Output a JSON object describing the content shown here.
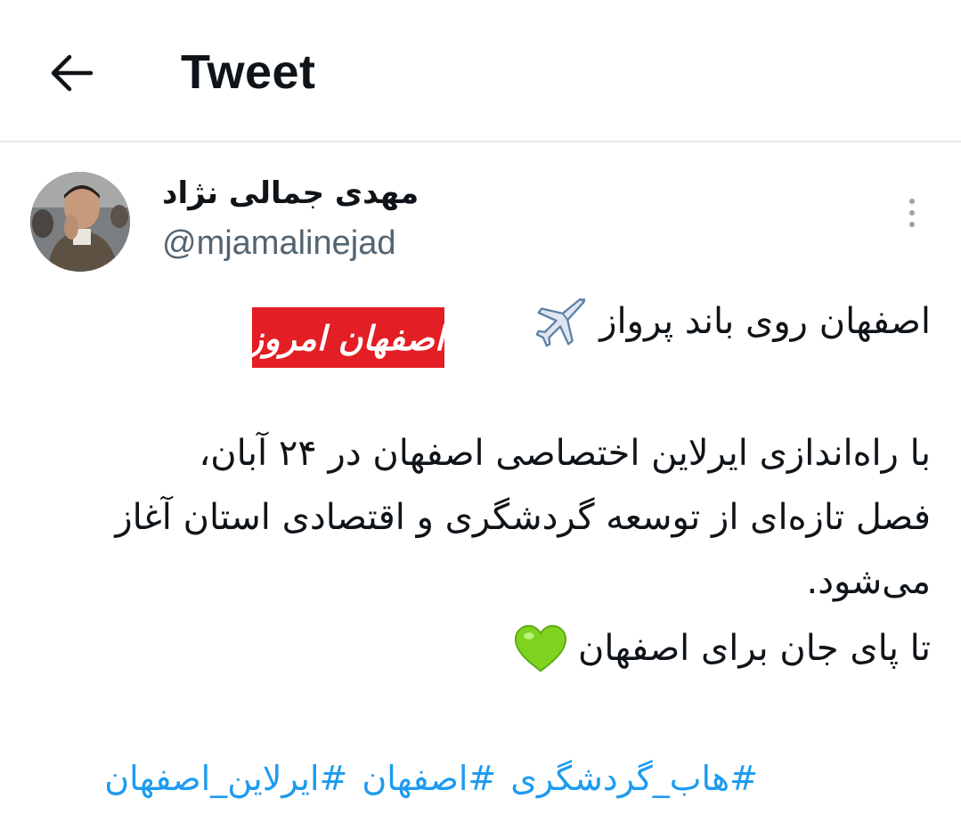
{
  "header": {
    "title": "Tweet",
    "back_icon": "arrow-left-icon"
  },
  "author": {
    "display_name": "مهدی جمالی نژاد",
    "handle": "@mjamalinejad",
    "more_icon": "more-vertical-icon"
  },
  "tweet": {
    "headline": "اصفهان روی باند پرواز",
    "headline_emoji": "airplane-icon",
    "brand_logo_text": "اصفهان امروز",
    "lines": [
      "با راه‌اندازی ایرلاین اختصاصی اصفهان در ۲۴ آبان،",
      "فصل تازه‌ای از توسعه گردشگری و اقتصادی استان آغاز",
      "می‌شود."
    ],
    "closing": "تا پای جان برای اصفهان",
    "closing_emoji": "green-heart-icon",
    "hashtags": [
      "#هاب_گردشگری",
      "#اصفهان",
      "#ایرلاین_اصفهان"
    ]
  },
  "colors": {
    "link": "#1d9bf0",
    "secondary_text": "#536471",
    "logo_red": "#e31e24",
    "heart_green": "#7ed321"
  }
}
